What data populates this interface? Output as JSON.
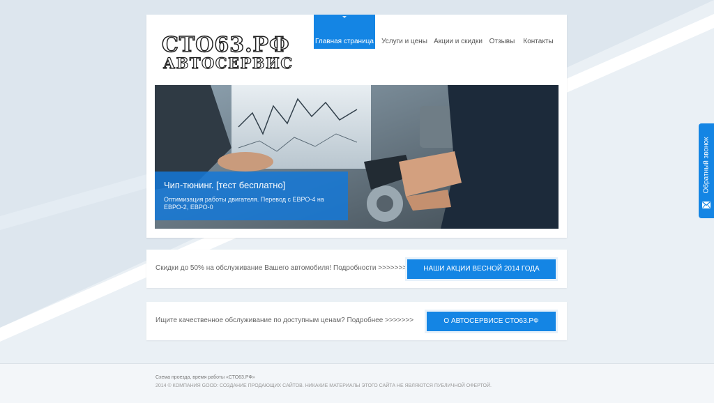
{
  "logo": {
    "line1": "СТО63.РФ",
    "line2": "АВТОСЕРВИС"
  },
  "nav": {
    "items": [
      {
        "label": "Главная страница",
        "active": true
      },
      {
        "label": "Услуги и цены",
        "active": false
      },
      {
        "label": "Акции и скидки",
        "active": false
      },
      {
        "label": "Отзывы",
        "active": false
      },
      {
        "label": "Контакты",
        "active": false
      }
    ]
  },
  "slider": {
    "title": "Чип-тюнинг. [тест бесплатно]",
    "subtitle": "Оптимизация работы двигателя. Перевод с ЕВРО-4 на ЕВРО-2, ЕВРО-0"
  },
  "promos": [
    {
      "text": "Скидки до 50% на обслуживание Вашего автомобиля! Подробности >>>>>>>",
      "button": "НАШИ АКЦИИ ВЕСНОЙ 2014 ГОДА"
    },
    {
      "text": "Ищите качественное обслуживание по доступным ценам? Подробнее >>>>>>>",
      "button": "О АВТОСЕРВИСЕ СТО63.РФ"
    }
  ],
  "footer": {
    "line1": "Схема проезда, время работы «СТО63.РФ»",
    "line2": "2014 © КОМПАНИЯ GOOD: СОЗДАНИЕ ПРОДАЮЩИХ САЙТОВ. НИКАКИЕ МАТЕРИАЛЫ ЭТОГО САЙТА НЕ ЯВЛЯЮТСЯ ПУБЛИЧНОЙ ОФЕРТОЙ."
  },
  "callback": {
    "label": "Обратный звонок",
    "icon": "mail-icon"
  },
  "colors": {
    "accent": "#1485e4",
    "background": "#dde6ee"
  }
}
